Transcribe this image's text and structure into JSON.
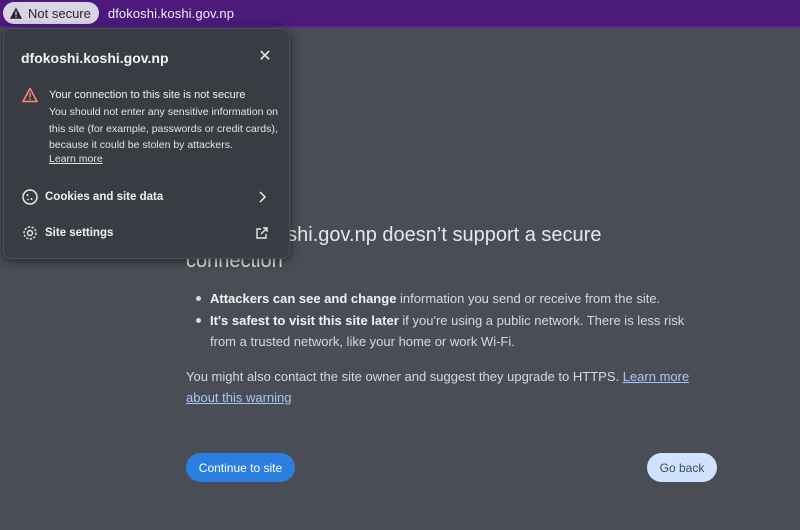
{
  "addressbar": {
    "security_label": "Not secure",
    "url": "dfokoshi.koshi.gov.np",
    "background": "#4b1a7a"
  },
  "popup": {
    "domain": "dfokoshi.koshi.gov.np",
    "close_icon": "close-icon",
    "warning_icon": "warning-triangle-icon",
    "warning_title": "Your connection to this site is not secure",
    "warning_body": "You should not enter any sensitive information on this site (for example, passwords or credit cards), because it could be stolen by attackers.",
    "learn_more": "Learn more",
    "rows": [
      {
        "icon": "cookie-icon",
        "label": "Cookies and site data",
        "trailing_icon": "chevron-right-icon"
      },
      {
        "icon": "gear-icon",
        "label": "Site settings",
        "trailing_icon": "open-external-icon"
      }
    ]
  },
  "interstitial": {
    "heading": "dfokoshi.koshi.gov.np doesn’t support a secure connection",
    "bullets": [
      {
        "bold": "Attackers can see and change",
        "rest": " information you send or receive from the site."
      },
      {
        "bold": "It's safest to visit this site later",
        "rest": " if you're using a public network. There is less risk from a trusted network, like your home or work Wi-Fi."
      }
    ],
    "contact_text": "You might also contact the site owner and suggest they upgrade to HTTPS. ",
    "contact_link": "Learn more about this warning",
    "continue_button": "Continue to site",
    "back_button": "Go back",
    "accent": "#2b7fe0"
  }
}
